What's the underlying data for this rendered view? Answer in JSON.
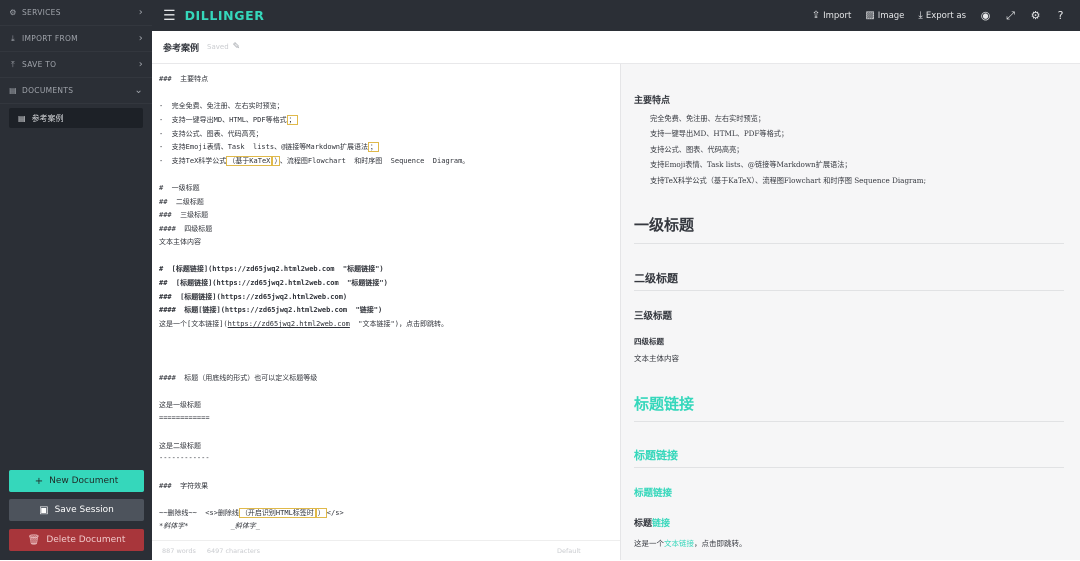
{
  "sidebar": {
    "items": [
      {
        "label": "SERVICES",
        "icon": "gear-icon"
      },
      {
        "label": "IMPORT FROM",
        "icon": "import-icon"
      },
      {
        "label": "SAVE TO",
        "icon": "save-icon"
      },
      {
        "label": "DOCUMENTS",
        "icon": "folder-icon"
      }
    ],
    "document": "参考案例",
    "buttons": {
      "new": "New Document",
      "save": "Save Session",
      "delete": "Delete Document"
    }
  },
  "topnav": {
    "logo": "DILLINGER",
    "import": "Import",
    "image": "Image",
    "export": "Export as"
  },
  "doc": {
    "title": "参考案例",
    "saved": "Saved"
  },
  "editor": {
    "l1": "###  主要特点",
    "l2": "-  完全免费、免注册、左右实时预览；",
    "l3a": "-  支持一键导出MD、HTML、PDF等格式",
    "l3b": "；",
    "l4": "-  支持公式、图表、代码高亮；",
    "l5a": "-  支持Emoji表情、Task  lists、@链接等Markdown扩展语法",
    "l5b": "；",
    "l6a": "-  支持TeX科学公式",
    "l6b": "（基于KaTeX",
    "l6c": "）",
    "l6d": "、流程图Flowchart  和时序图  Sequence  Diagram。",
    "l7": "#  一级标题",
    "l8": "##  二级标题",
    "l9": "###  三级标题",
    "l10": "####  四级标题",
    "l11": "文本主体内容",
    "l12": "#  [标题链接](https://zd65jwq2.html2web.com  \"标题链接\")",
    "l13": "##  [标题链接](https://zd65jwq2.html2web.com  \"标题链接\")",
    "l14": "###  [标题链接](https://zd65jwq2.html2web.com)",
    "l15": "####  标题[链接](https://zd65jwq2.html2web.com  \"链接\")",
    "l16a": "这是一个[文本链接](",
    "l16b": "https://zd65jwq2.html2web.com",
    "l16c": "  \"文本链接\")，点击即跳转。",
    "l17": "####  标题（用底线的形式）也可以定义标题等级",
    "l18": "这是一级标题",
    "l19": "============",
    "l20": "这是二级标题",
    "l21": "------------",
    "l22": "###  字符效果",
    "l23a": "~~删除线~~  <s>删除线",
    "l23b": "（开启识别HTML标签时",
    "l23c": "）",
    "l23d": "</s>",
    "l24": "*斜体字*          _斜体字_"
  },
  "status": {
    "words": "887 words",
    "chars": "6497 characters",
    "mode": "Default"
  },
  "preview": {
    "h_features": "主要特点",
    "li": [
      "完全免费、免注册、左右实时预览；",
      "支持一键导出MD、HTML、PDF等格式；",
      "支持公式、图表、代码高亮；",
      "支持Emoji表情、Task lists、@链接等Markdown扩展语法；",
      "支持TeX科学公式（基于KaTeX）、流程图Flowchart 和时序图 Sequence Diagram;"
    ],
    "h1": "一级标题",
    "h2": "二级标题",
    "h3": "三级标题",
    "h4": "四级标题",
    "body": "文本主体内容",
    "link_h1": "标题链接",
    "link_h2": "标题链接",
    "link_h3": "标题链接",
    "h4_prefix": "标题",
    "h4_link": "链接",
    "text_prefix": "这是一个",
    "text_link": "文本链接",
    "text_suffix": "，点击即跳转。"
  },
  "colors": {
    "accent": "#35d7bb",
    "sidebar": "#2b2f36",
    "danger": "#a8363b"
  }
}
